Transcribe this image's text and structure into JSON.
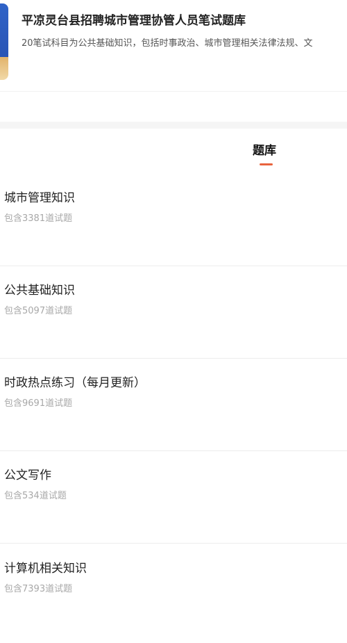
{
  "book": {
    "title": "平凉灵台县招聘城市管理协管人员笔试题库",
    "description": "20笔试科目为公共基础知识，包括时事政治、城市管理相关法律法规、文"
  },
  "tabs": [
    {
      "label": "题库",
      "active": true,
      "indicator_color": "#e8633d"
    }
  ],
  "sections": [
    {
      "title": "城市管理知识",
      "count_text": "包含3381道试题"
    },
    {
      "title": "公共基础知识",
      "count_text": "包含5097道试题"
    },
    {
      "title": "时政热点练习（每月更新）",
      "count_text": "包含9691道试题"
    },
    {
      "title": "公文写作",
      "count_text": "包含534道试题"
    },
    {
      "title": "计算机相关知识",
      "count_text": "包含7393道试题"
    }
  ]
}
